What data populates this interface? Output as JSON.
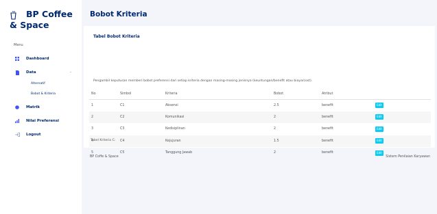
{
  "brand": {
    "name": "BP Coffee & Space",
    "icon": "coffee-cup-icon"
  },
  "sidebar": {
    "heading": "Menu",
    "items": [
      {
        "label": "Dashboard",
        "icon": "grid-icon"
      },
      {
        "label": "Data",
        "icon": "document-icon",
        "expanded": true,
        "children": [
          {
            "label": "Alternatif"
          },
          {
            "label": "Bobot & Kriteria"
          }
        ]
      },
      {
        "label": "Matrik",
        "icon": "matrix-icon"
      },
      {
        "label": "Nilai Preferensi",
        "icon": "bar-chart-icon"
      },
      {
        "label": "Logout",
        "icon": "logout-icon"
      }
    ]
  },
  "page": {
    "title": "Bobot Kriteria"
  },
  "card": {
    "title": "Tabel Bobot Kriteria",
    "description": "Pengambil keputusan memberi bobot preferensi dari setiap kriteria dengan masing-masing jenisnya (keuntungan/benefit atau biaya/cost).",
    "caption": "Tabel Kriteria Cᵢ",
    "table": {
      "headers": [
        "No",
        "Simbol",
        "Kriteria",
        "Bobot",
        "Atribut",
        ""
      ],
      "rows": [
        {
          "no": "1",
          "simbol": "C1",
          "kriteria": "Absensi",
          "bobot": "2.5",
          "atribut": "benefit",
          "action": "Edit"
        },
        {
          "no": "2",
          "simbol": "C2",
          "kriteria": "Komunikasi",
          "bobot": "2",
          "atribut": "benefit",
          "action": "Edit"
        },
        {
          "no": "3",
          "simbol": "C3",
          "kriteria": "Kedisiplinan",
          "bobot": "2",
          "atribut": "benefit",
          "action": "Edit"
        },
        {
          "no": "4",
          "simbol": "C4",
          "kriteria": "Kejujuran",
          "bobot": "1.5",
          "atribut": "benefit",
          "action": "Edit"
        },
        {
          "no": "5",
          "simbol": "C5",
          "kriteria": "Tanggung Jawab",
          "bobot": "2",
          "atribut": "benefit",
          "action": "Edit"
        }
      ]
    }
  },
  "footer": {
    "left": "BP Coffe & Space",
    "right": "Sistem Penilaian Karyawan"
  },
  "colors": {
    "navy": "#012970",
    "edit_button": "#0dcaf0",
    "background": "#f3f5fb"
  }
}
